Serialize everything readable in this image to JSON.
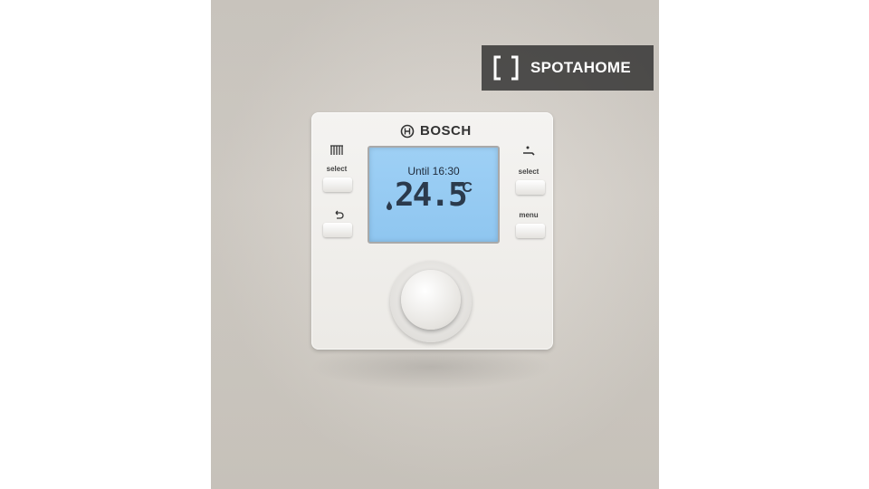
{
  "watermark": {
    "text": "SPOTAHOME"
  },
  "device": {
    "brand": "BOSCH",
    "display": {
      "status": "Until 16:30",
      "temperature": "24.5",
      "unit": "°C"
    },
    "left_select_label": "select",
    "right_select_label": "select",
    "menu_label": "menu"
  },
  "icons": {
    "brand_logo": "bosch-logo-icon",
    "left_top": "radiator-icon",
    "left_bottom": "back-arrow-icon",
    "right_top": "hot-water-tap-icon",
    "display_left": "flame-icon",
    "watermark_logo": "spotahome-bracket-icon"
  },
  "colors": {
    "screen": "#9ed0f5",
    "watermark_bg": "#282828"
  }
}
